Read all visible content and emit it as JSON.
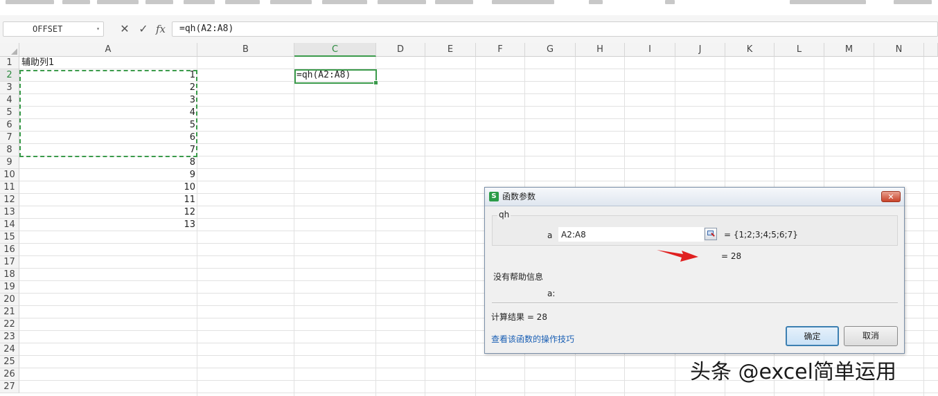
{
  "formula_bar": {
    "name_box": "OFFSET",
    "cancel_glyph": "✕",
    "enter_glyph": "✓",
    "fx_label": "fx",
    "formula": "=qh(A2:A8)"
  },
  "columns": [
    "A",
    "B",
    "C",
    "D",
    "E",
    "F",
    "G",
    "H",
    "I",
    "J",
    "K",
    "L",
    "M",
    "N"
  ],
  "selected_column": "C",
  "rows": [
    "1",
    "2",
    "3",
    "4",
    "5",
    "6",
    "7",
    "8",
    "9",
    "10",
    "11",
    "12",
    "13",
    "14",
    "15",
    "16",
    "17",
    "18",
    "19",
    "20",
    "21",
    "22",
    "23",
    "24",
    "25",
    "26",
    "27"
  ],
  "selected_row": "2",
  "cells": {
    "A1": "辅助列1",
    "A2": "1",
    "A3": "2",
    "A4": "3",
    "A5": "4",
    "A6": "5",
    "A7": "6",
    "A8": "7",
    "A9": "8",
    "A10": "9",
    "A11": "10",
    "A12": "11",
    "A13": "12",
    "A14": "13",
    "C2": "=qh(A2:A8)"
  },
  "dialog": {
    "title": "函数参数",
    "logo_letter": "S",
    "close_glyph": "✕",
    "function_name": "qh",
    "arg_label": "a",
    "arg_value": "A2:A8",
    "arg_evaluated": "= {1;2;3;4;5;6;7}",
    "result_inline": "=  28",
    "help_text": "没有帮助信息",
    "arg_desc_label": "a:",
    "calc_result": "计算结果 =  28",
    "help_link": "查看该函数的操作技巧",
    "ok_label": "确定",
    "cancel_label": "取消"
  },
  "watermark": "头条 @excel简单运用",
  "colors": {
    "selection_green": "#3a9a4a",
    "arrow_red": "#e02020",
    "link_blue": "#1a5fb4"
  }
}
